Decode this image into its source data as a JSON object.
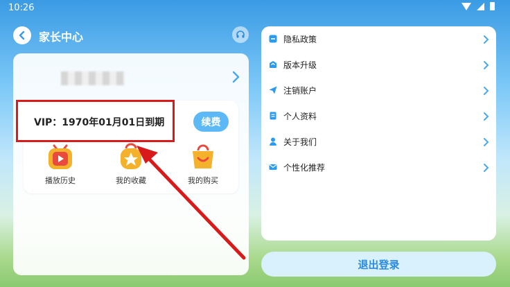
{
  "status": {
    "time": "10:26"
  },
  "header": {
    "title": "家长中心"
  },
  "vip": {
    "text": "VIP：1970年01月01日到期",
    "renew_label": "续费"
  },
  "features": [
    {
      "label": "播放历史",
      "icon": "play-history-icon"
    },
    {
      "label": "我的收藏",
      "icon": "favorites-icon"
    },
    {
      "label": "我的购买",
      "icon": "purchase-bag-icon"
    }
  ],
  "menu": {
    "items": [
      {
        "label": "隐私政策",
        "icon": "privacy-icon"
      },
      {
        "label": "版本升级",
        "icon": "upgrade-icon"
      },
      {
        "label": "注销账户",
        "icon": "send-icon"
      },
      {
        "label": "个人资料",
        "icon": "profile-doc-icon"
      },
      {
        "label": "关于我们",
        "icon": "person-icon"
      },
      {
        "label": "个性化推荐",
        "icon": "mail-icon"
      }
    ]
  },
  "footer": {
    "logout_label": "退出登录"
  },
  "colors": {
    "accent": "#2a8ae0",
    "highlight": "#d91a1a",
    "renew": "#5cb9f5"
  }
}
